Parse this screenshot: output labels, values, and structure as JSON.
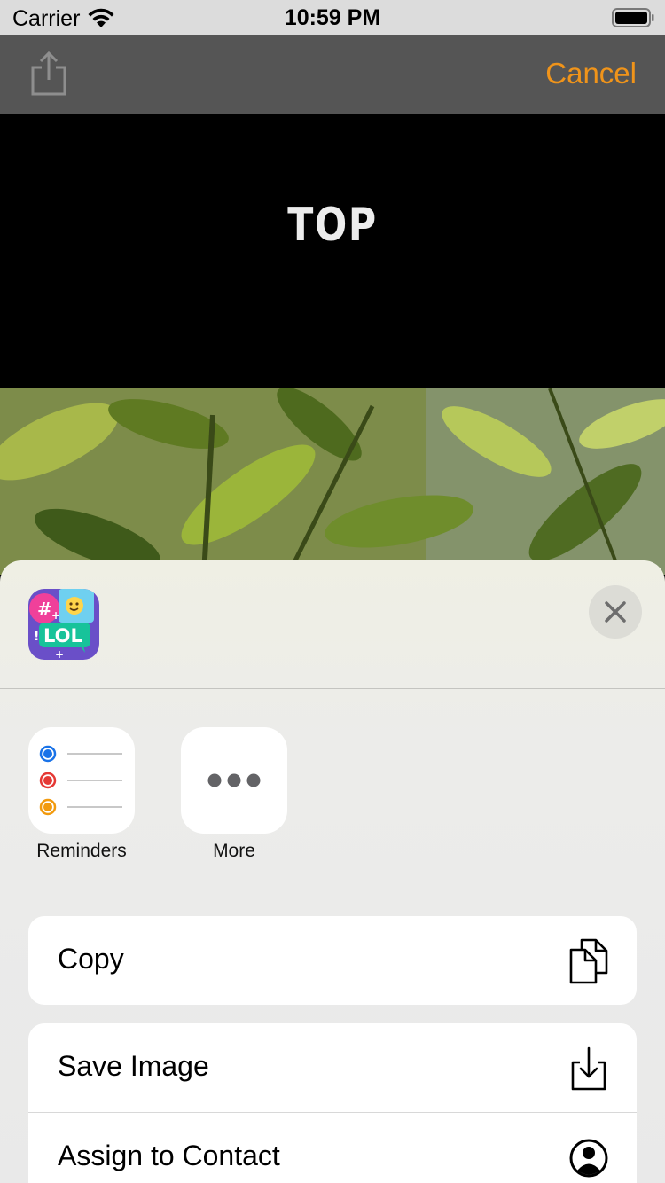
{
  "status_bar": {
    "carrier": "Carrier",
    "time": "10:59 PM"
  },
  "nav_bar": {
    "cancel_label": "Cancel",
    "share_icon": "share-icon"
  },
  "meme": {
    "top_text": "TOP"
  },
  "share_sheet": {
    "app_icon": "lol-meme-app-icon",
    "apps": [
      {
        "label": "Reminders",
        "icon": "reminders-icon"
      },
      {
        "label": "More",
        "icon": "more-icon"
      }
    ],
    "actions": {
      "copy": {
        "label": "Copy",
        "icon": "copy-icon"
      },
      "save_image": {
        "label": "Save Image",
        "icon": "save-icon"
      },
      "assign_contact": {
        "label": "Assign to Contact",
        "icon": "contact-icon"
      }
    },
    "colors": {
      "reminder_blue": "#1a73e8",
      "reminder_red": "#e53935",
      "reminder_orange": "#f29a0e",
      "accent": "#f0941a"
    }
  }
}
